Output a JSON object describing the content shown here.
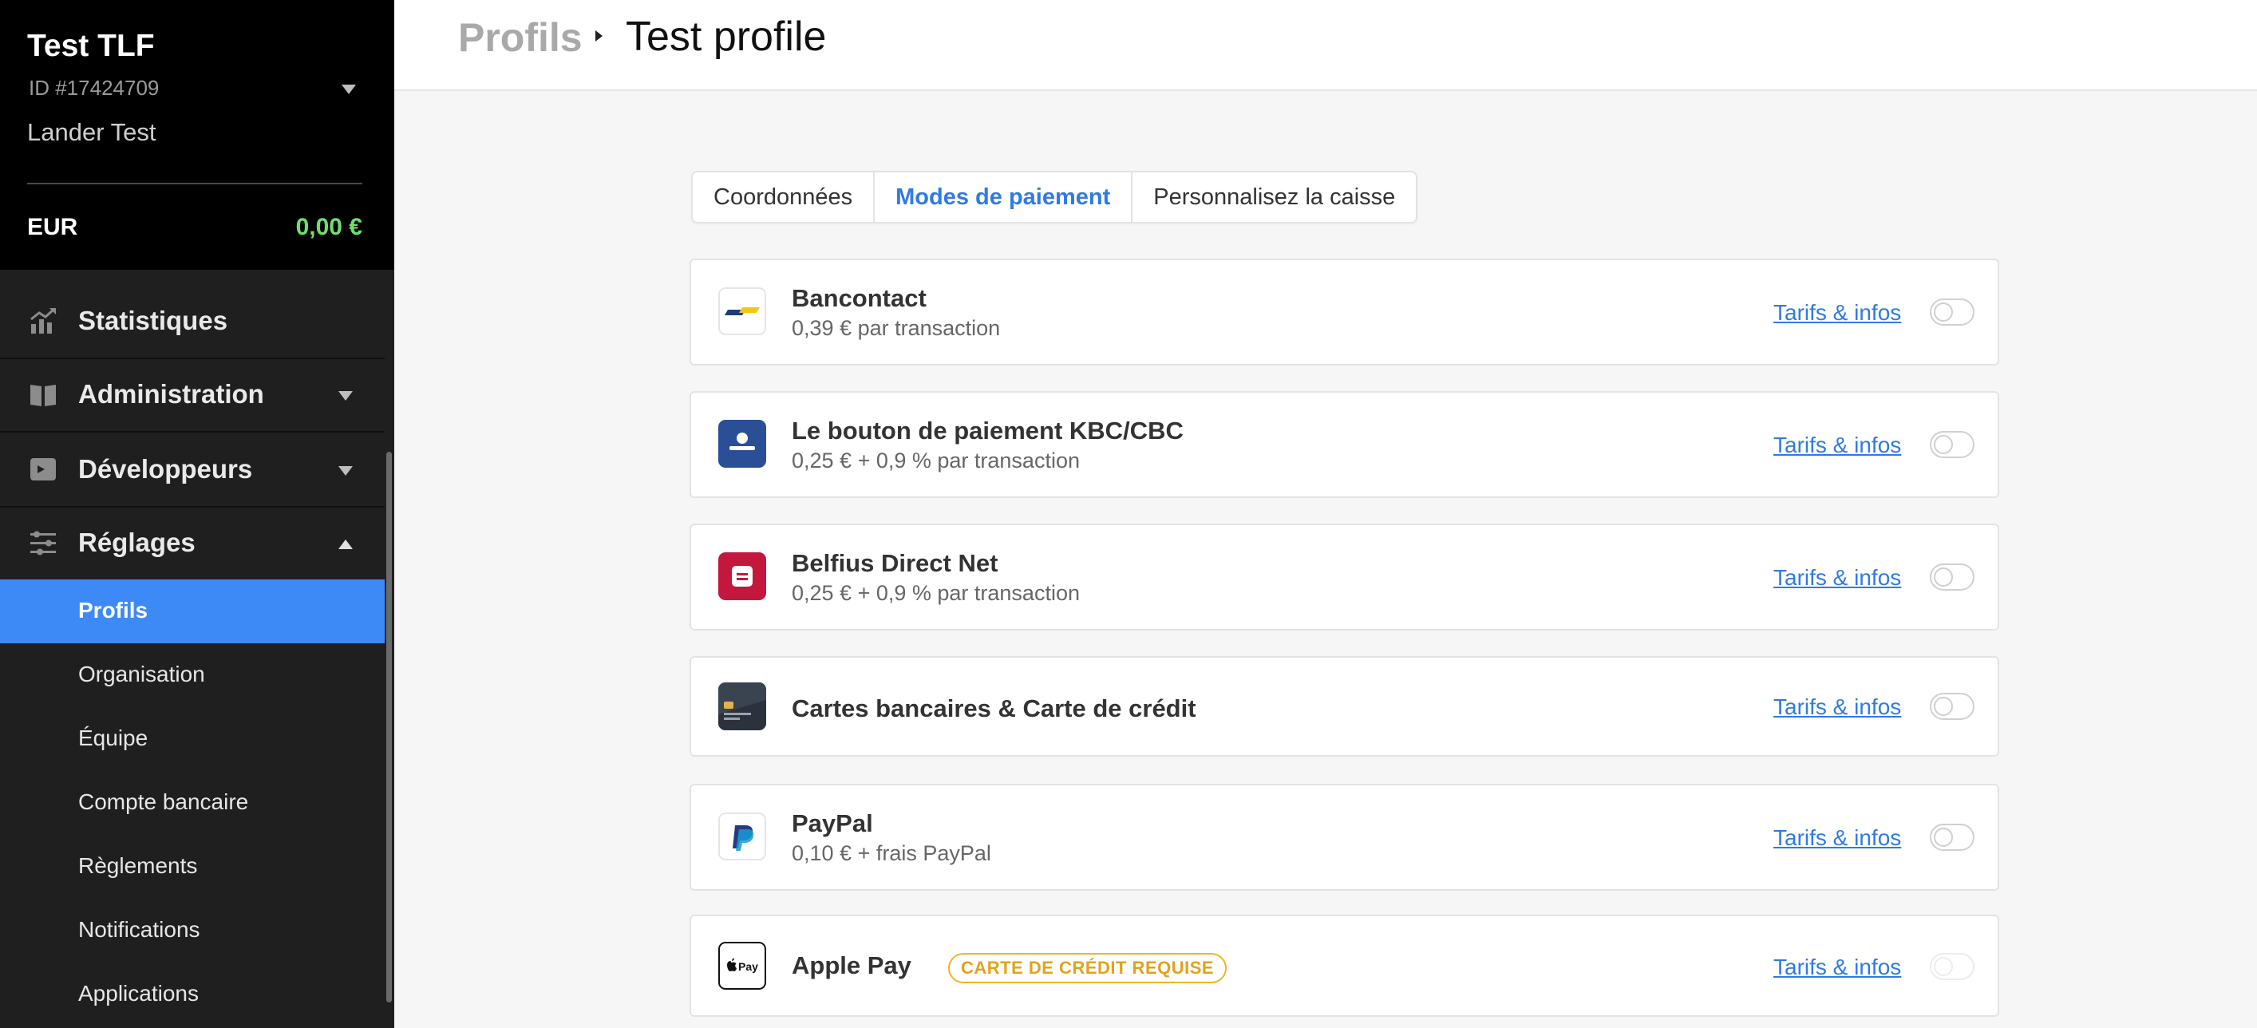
{
  "account": {
    "name": "Test TLF",
    "id": "ID #17424709",
    "user": "Lander Test",
    "currency": "EUR",
    "balance": "0,00 €",
    "balance_color": "#6fe06b"
  },
  "nav": {
    "items": [
      {
        "label": "Statistiques",
        "icon": "chart-icon"
      },
      {
        "label": "Administration",
        "icon": "book-icon"
      },
      {
        "label": "Développeurs",
        "icon": "terminal-icon"
      },
      {
        "label": "Réglages",
        "icon": "sliders-icon"
      }
    ],
    "settings_sub": [
      "Profils",
      "Organisation",
      "Équipe",
      "Compte bancaire",
      "Règlements",
      "Notifications",
      "Applications"
    ],
    "active_sub": "Profils",
    "active_color": "#3d8af7"
  },
  "header": {
    "breadcrumb_root": "Profils",
    "breadcrumb_current": "Test profile"
  },
  "tabs": [
    {
      "label": "Coordonnées",
      "active": false
    },
    {
      "label": "Modes de paiement",
      "active": true
    },
    {
      "label": "Personnalisez la caisse",
      "active": false
    }
  ],
  "payment_methods": [
    {
      "name": "Bancontact",
      "fee": "0,39 € par transaction",
      "link": "Tarifs & infos",
      "enabled": false,
      "icon": "bancontact-icon"
    },
    {
      "name": "Le bouton de paiement KBC/CBC",
      "fee": "0,25 € + 0,9 % par transaction",
      "link": "Tarifs & infos",
      "enabled": false,
      "icon": "kbc-icon"
    },
    {
      "name": "Belfius Direct Net",
      "fee": "0,25 € + 0,9 % par transaction",
      "link": "Tarifs & infos",
      "enabled": false,
      "icon": "belfius-icon"
    },
    {
      "name": "Cartes bancaires & Carte de crédit",
      "fee": "",
      "link": "Tarifs & infos",
      "enabled": false,
      "icon": "credit-card-icon"
    },
    {
      "name": "PayPal",
      "fee": "0,10 € + frais PayPal",
      "link": "Tarifs & infos",
      "enabled": false,
      "icon": "paypal-icon"
    },
    {
      "name": "Apple Pay",
      "badge": "CARTE DE CRÉDIT REQUISE",
      "link": "Tarifs & infos",
      "enabled": false,
      "disabled": true,
      "icon": "apple-pay-icon"
    }
  ],
  "link_color": "#2f7ae5",
  "badge_color": "#f0b429"
}
